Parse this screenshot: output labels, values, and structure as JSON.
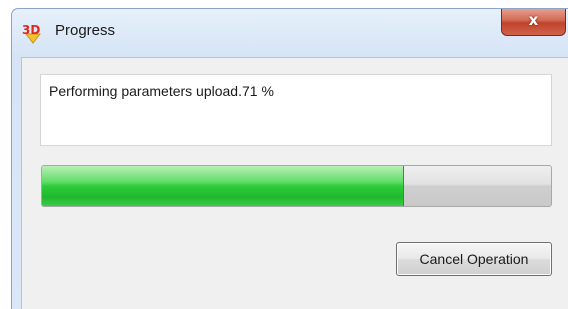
{
  "window": {
    "title": "Progress",
    "close_glyph": "x",
    "icon": "3d-app-icon"
  },
  "message": {
    "text": "Performing parameters upload.71 %"
  },
  "progress": {
    "value_percent": 71
  },
  "buttons": {
    "cancel_label": "Cancel Operation"
  },
  "colors": {
    "progress_green": "#2fcc3c",
    "close_red": "#c0432c",
    "titlebar_blue": "#d6e4f6"
  }
}
